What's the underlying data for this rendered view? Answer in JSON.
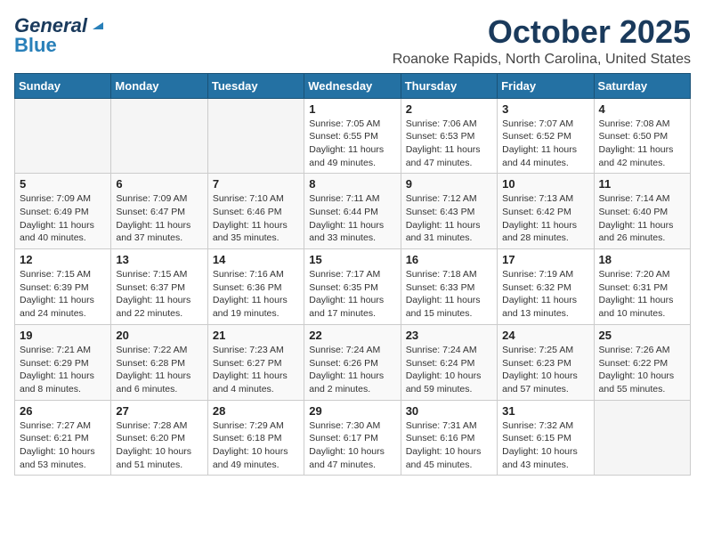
{
  "header": {
    "logo_general": "General",
    "logo_blue": "Blue",
    "month_title": "October 2025",
    "location": "Roanoke Rapids, North Carolina, United States"
  },
  "weekdays": [
    "Sunday",
    "Monday",
    "Tuesday",
    "Wednesday",
    "Thursday",
    "Friday",
    "Saturday"
  ],
  "weeks": [
    [
      {
        "day": "",
        "info": ""
      },
      {
        "day": "",
        "info": ""
      },
      {
        "day": "",
        "info": ""
      },
      {
        "day": "1",
        "info": "Sunrise: 7:05 AM\nSunset: 6:55 PM\nDaylight: 11 hours\nand 49 minutes."
      },
      {
        "day": "2",
        "info": "Sunrise: 7:06 AM\nSunset: 6:53 PM\nDaylight: 11 hours\nand 47 minutes."
      },
      {
        "day": "3",
        "info": "Sunrise: 7:07 AM\nSunset: 6:52 PM\nDaylight: 11 hours\nand 44 minutes."
      },
      {
        "day": "4",
        "info": "Sunrise: 7:08 AM\nSunset: 6:50 PM\nDaylight: 11 hours\nand 42 minutes."
      }
    ],
    [
      {
        "day": "5",
        "info": "Sunrise: 7:09 AM\nSunset: 6:49 PM\nDaylight: 11 hours\nand 40 minutes."
      },
      {
        "day": "6",
        "info": "Sunrise: 7:09 AM\nSunset: 6:47 PM\nDaylight: 11 hours\nand 37 minutes."
      },
      {
        "day": "7",
        "info": "Sunrise: 7:10 AM\nSunset: 6:46 PM\nDaylight: 11 hours\nand 35 minutes."
      },
      {
        "day": "8",
        "info": "Sunrise: 7:11 AM\nSunset: 6:44 PM\nDaylight: 11 hours\nand 33 minutes."
      },
      {
        "day": "9",
        "info": "Sunrise: 7:12 AM\nSunset: 6:43 PM\nDaylight: 11 hours\nand 31 minutes."
      },
      {
        "day": "10",
        "info": "Sunrise: 7:13 AM\nSunset: 6:42 PM\nDaylight: 11 hours\nand 28 minutes."
      },
      {
        "day": "11",
        "info": "Sunrise: 7:14 AM\nSunset: 6:40 PM\nDaylight: 11 hours\nand 26 minutes."
      }
    ],
    [
      {
        "day": "12",
        "info": "Sunrise: 7:15 AM\nSunset: 6:39 PM\nDaylight: 11 hours\nand 24 minutes."
      },
      {
        "day": "13",
        "info": "Sunrise: 7:15 AM\nSunset: 6:37 PM\nDaylight: 11 hours\nand 22 minutes."
      },
      {
        "day": "14",
        "info": "Sunrise: 7:16 AM\nSunset: 6:36 PM\nDaylight: 11 hours\nand 19 minutes."
      },
      {
        "day": "15",
        "info": "Sunrise: 7:17 AM\nSunset: 6:35 PM\nDaylight: 11 hours\nand 17 minutes."
      },
      {
        "day": "16",
        "info": "Sunrise: 7:18 AM\nSunset: 6:33 PM\nDaylight: 11 hours\nand 15 minutes."
      },
      {
        "day": "17",
        "info": "Sunrise: 7:19 AM\nSunset: 6:32 PM\nDaylight: 11 hours\nand 13 minutes."
      },
      {
        "day": "18",
        "info": "Sunrise: 7:20 AM\nSunset: 6:31 PM\nDaylight: 11 hours\nand 10 minutes."
      }
    ],
    [
      {
        "day": "19",
        "info": "Sunrise: 7:21 AM\nSunset: 6:29 PM\nDaylight: 11 hours\nand 8 minutes."
      },
      {
        "day": "20",
        "info": "Sunrise: 7:22 AM\nSunset: 6:28 PM\nDaylight: 11 hours\nand 6 minutes."
      },
      {
        "day": "21",
        "info": "Sunrise: 7:23 AM\nSunset: 6:27 PM\nDaylight: 11 hours\nand 4 minutes."
      },
      {
        "day": "22",
        "info": "Sunrise: 7:24 AM\nSunset: 6:26 PM\nDaylight: 11 hours\nand 2 minutes."
      },
      {
        "day": "23",
        "info": "Sunrise: 7:24 AM\nSunset: 6:24 PM\nDaylight: 10 hours\nand 59 minutes."
      },
      {
        "day": "24",
        "info": "Sunrise: 7:25 AM\nSunset: 6:23 PM\nDaylight: 10 hours\nand 57 minutes."
      },
      {
        "day": "25",
        "info": "Sunrise: 7:26 AM\nSunset: 6:22 PM\nDaylight: 10 hours\nand 55 minutes."
      }
    ],
    [
      {
        "day": "26",
        "info": "Sunrise: 7:27 AM\nSunset: 6:21 PM\nDaylight: 10 hours\nand 53 minutes."
      },
      {
        "day": "27",
        "info": "Sunrise: 7:28 AM\nSunset: 6:20 PM\nDaylight: 10 hours\nand 51 minutes."
      },
      {
        "day": "28",
        "info": "Sunrise: 7:29 AM\nSunset: 6:18 PM\nDaylight: 10 hours\nand 49 minutes."
      },
      {
        "day": "29",
        "info": "Sunrise: 7:30 AM\nSunset: 6:17 PM\nDaylight: 10 hours\nand 47 minutes."
      },
      {
        "day": "30",
        "info": "Sunrise: 7:31 AM\nSunset: 6:16 PM\nDaylight: 10 hours\nand 45 minutes."
      },
      {
        "day": "31",
        "info": "Sunrise: 7:32 AM\nSunset: 6:15 PM\nDaylight: 10 hours\nand 43 minutes."
      },
      {
        "day": "",
        "info": ""
      }
    ]
  ]
}
